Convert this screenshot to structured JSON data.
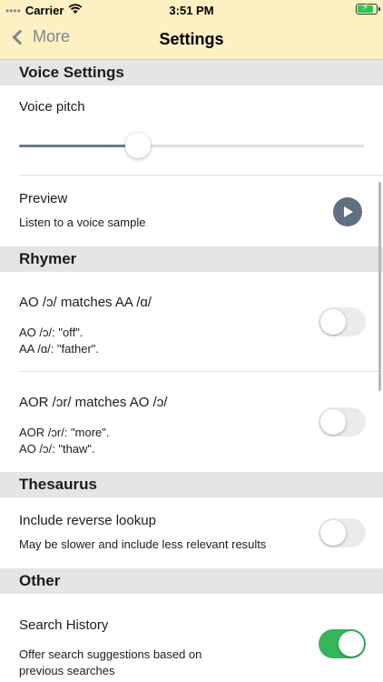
{
  "status_bar": {
    "carrier": "Carrier",
    "time": "3:51 PM",
    "signal_icon": "wifi-icon",
    "battery_icon": "battery-charging-icon"
  },
  "nav": {
    "back_label": "More",
    "title": "Settings"
  },
  "sections": {
    "voice": {
      "header": "Voice Settings",
      "pitch_label": "Voice pitch",
      "pitch_value_fraction": 0.34,
      "preview_label": "Preview",
      "preview_sub": "Listen to a voice sample"
    },
    "rhymer": {
      "header": "Rhymer",
      "item1_title": "AO /ɔ/ matches AA /ɑ/",
      "item1_line1": "AO /ɔ/: \"off\".",
      "item1_line2": "AA /ɑ/: \"father\".",
      "item1_on": false,
      "item2_title": "AOR /ɔr/ matches AO /ɔ/",
      "item2_line1": "AOR /ɔr/: \"more\".",
      "item2_line2": "AO /ɔ/: \"thaw\".",
      "item2_on": false
    },
    "thesaurus": {
      "header": "Thesaurus",
      "reverse_label": "Include reverse lookup",
      "reverse_sub": "May be slower and include less relevant results",
      "reverse_on": false
    },
    "other": {
      "header": "Other",
      "history_label": "Search History",
      "history_sub1": "Offer search suggestions based on",
      "history_sub2": "previous searches",
      "history_on": true
    }
  },
  "colors": {
    "bar_bg": "#fdf0c2",
    "section_bg": "#e5e5e5",
    "toggle_on": "#34b55a",
    "accent": "#5f7181"
  }
}
